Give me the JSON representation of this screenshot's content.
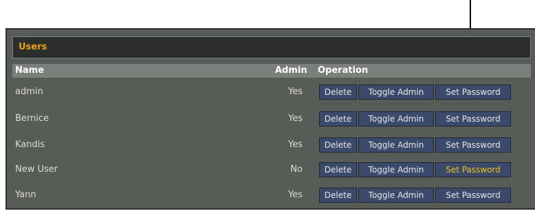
{
  "panel": {
    "title": "Users",
    "columns": {
      "name": "Name",
      "admin": "Admin",
      "operation": "Operation"
    }
  },
  "buttons": {
    "delete": "Delete",
    "toggle_admin": "Toggle Admin",
    "set_password": "Set Password"
  },
  "users": [
    {
      "name": "admin",
      "admin": "Yes"
    },
    {
      "name": "Bernice",
      "admin": "Yes"
    },
    {
      "name": "Kandis",
      "admin": "Yes"
    },
    {
      "name": "New User",
      "admin": "No"
    },
    {
      "name": "Yann",
      "admin": "Yes"
    }
  ],
  "colors": {
    "title": "#f2a01a",
    "button_bg": "#3b4a6b",
    "highlight_text": "#f0c419"
  }
}
